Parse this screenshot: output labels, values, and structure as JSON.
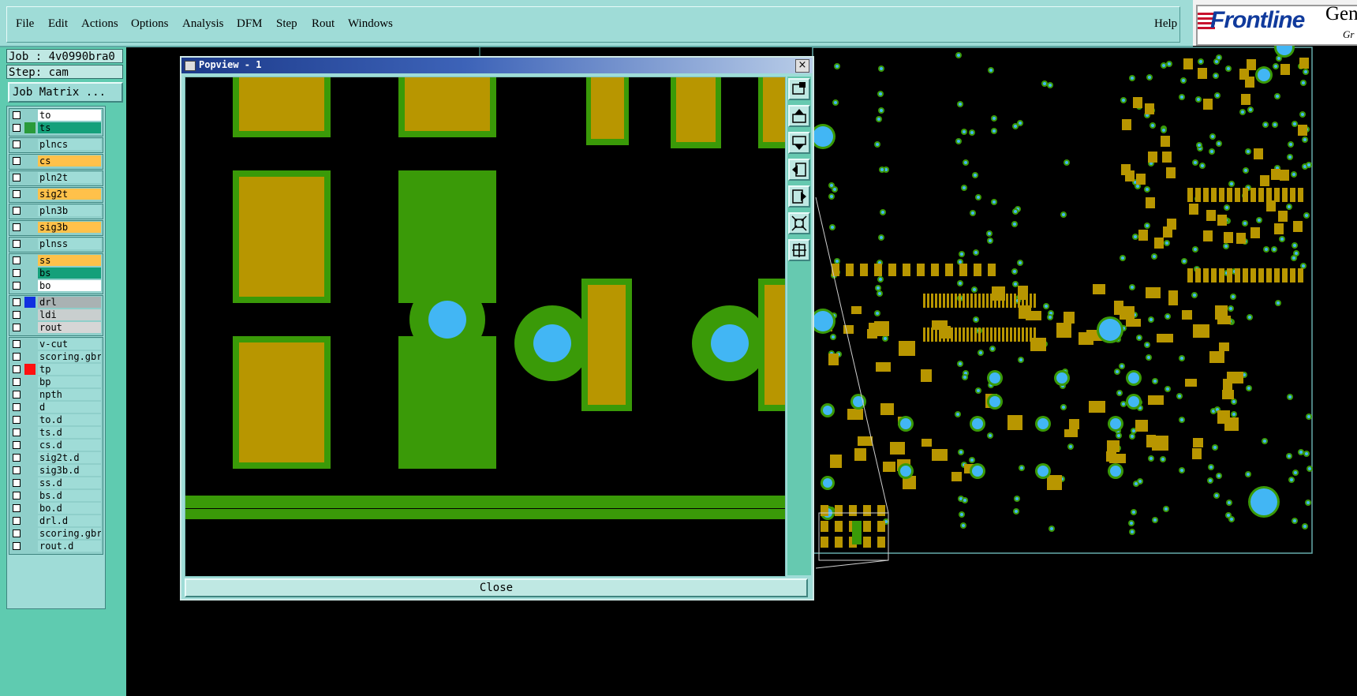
{
  "menu": {
    "items": [
      "File",
      "Edit",
      "Actions",
      "Options",
      "Analysis",
      "DFM",
      "Step",
      "Rout",
      "Windows"
    ],
    "help": "Help"
  },
  "logo": {
    "brand": "Frontline",
    "product": "Gen",
    "sub": "Gr"
  },
  "job": {
    "job_label": "Job : 4v0990bra0",
    "step_label": "Step: cam"
  },
  "job_matrix_label": "Job Matrix ...",
  "layer_groups": [
    [
      {
        "name": "to",
        "color": "#ffffff",
        "swatch": ""
      },
      {
        "name": "ts",
        "color": "#14a07a",
        "swatch": "#2a9a3a"
      }
    ],
    [
      {
        "name": "plncs",
        "color": "#9fdcd7",
        "swatch": ""
      }
    ],
    [
      {
        "name": "cs",
        "color": "#ffc14a",
        "swatch": ""
      }
    ],
    [
      {
        "name": "pln2t",
        "color": "#9fdcd7",
        "swatch": ""
      }
    ],
    [
      {
        "name": "sig2t",
        "color": "#ffc14a",
        "swatch": ""
      }
    ],
    [
      {
        "name": "pln3b",
        "color": "#9fdcd7",
        "swatch": ""
      }
    ],
    [
      {
        "name": "sig3b",
        "color": "#ffc14a",
        "swatch": ""
      }
    ],
    [
      {
        "name": "plnss",
        "color": "#9fdcd7",
        "swatch": ""
      }
    ],
    [
      {
        "name": "ss",
        "color": "#ffc14a",
        "swatch": ""
      },
      {
        "name": "bs",
        "color": "#14a07a",
        "swatch": ""
      },
      {
        "name": "bo",
        "color": "#ffffff",
        "swatch": ""
      }
    ],
    [
      {
        "name": "drl",
        "color": "#a9b2b3",
        "swatch": "#1030e0"
      },
      {
        "name": "ldi",
        "color": "#c9cfcf",
        "swatch": ""
      },
      {
        "name": "rout",
        "color": "#d6d6d6",
        "swatch": ""
      }
    ],
    [
      {
        "name": "v-cut",
        "color": "#9fdcd7",
        "swatch": ""
      },
      {
        "name": "scoring.gbr",
        "color": "#9fdcd7",
        "swatch": ""
      },
      {
        "name": "tp",
        "color": "#9fdcd7",
        "swatch": "#ff1010"
      },
      {
        "name": "bp",
        "color": "#9fdcd7",
        "swatch": ""
      },
      {
        "name": "npth",
        "color": "#9fdcd7",
        "swatch": ""
      },
      {
        "name": "d",
        "color": "#9fdcd7",
        "swatch": ""
      },
      {
        "name": "to.d",
        "color": "#9fdcd7",
        "swatch": ""
      },
      {
        "name": "ts.d",
        "color": "#9fdcd7",
        "swatch": ""
      },
      {
        "name": "cs.d",
        "color": "#9fdcd7",
        "swatch": ""
      },
      {
        "name": "sig2t.d",
        "color": "#9fdcd7",
        "swatch": ""
      },
      {
        "name": "sig3b.d",
        "color": "#9fdcd7",
        "swatch": ""
      },
      {
        "name": "ss.d",
        "color": "#9fdcd7",
        "swatch": ""
      },
      {
        "name": "bs.d",
        "color": "#9fdcd7",
        "swatch": ""
      },
      {
        "name": "bo.d",
        "color": "#9fdcd7",
        "swatch": ""
      },
      {
        "name": "drl.d",
        "color": "#9fdcd7",
        "swatch": ""
      },
      {
        "name": "scoring.gbr",
        "color": "#9fdcd7",
        "swatch": ""
      },
      {
        "name": "rout.d",
        "color": "#9fdcd7",
        "swatch": ""
      }
    ]
  ],
  "popview": {
    "title": "Popview - 1",
    "close_label": "Close",
    "close_x": "×"
  },
  "colors": {
    "pad": "#b89600",
    "copper": "#3a9a08",
    "drill": "#42b6f4",
    "outline": "#4f8f7a",
    "panel": "#5fcbb0"
  },
  "tool_icons": [
    "zoom-fit-icon",
    "pan-up-icon",
    "pan-down-icon",
    "pan-left-icon",
    "pan-right-icon",
    "zoom-in-icon",
    "zoom-out-icon"
  ]
}
